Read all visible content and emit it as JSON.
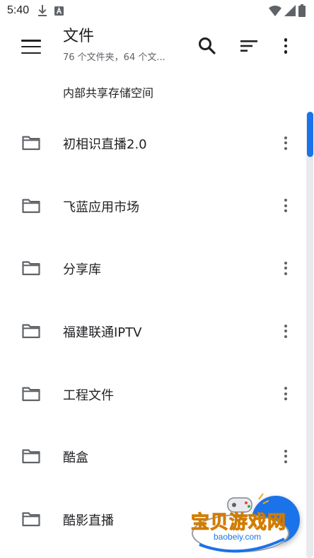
{
  "status_bar": {
    "time": "5:40",
    "icons": [
      "download-icon",
      "font-icon",
      "wifi-icon",
      "signal-icon",
      "battery-icon"
    ]
  },
  "app_bar": {
    "title": "文件",
    "subtitle": "76 个文件夹，64 个文...",
    "icons": [
      "menu-icon",
      "search-icon",
      "sort-icon",
      "more-vert-icon"
    ]
  },
  "storage": {
    "label": "内部共享存储空间"
  },
  "folders": [
    {
      "name": "初相识直播2.0"
    },
    {
      "name": "飞蓝应用市场"
    },
    {
      "name": "分享库"
    },
    {
      "name": "福建联通IPTV"
    },
    {
      "name": "工程文件"
    },
    {
      "name": "酷盒"
    },
    {
      "name": "酷影直播"
    }
  ],
  "colors": {
    "accent": "#1a73e8",
    "text": "#202124",
    "secondary_text": "#5f6368"
  },
  "watermark": {
    "brand": "宝贝游戏网",
    "url": "baobeiy.com"
  }
}
